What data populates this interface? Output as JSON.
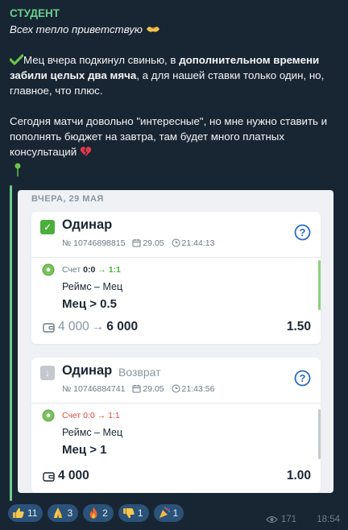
{
  "author": "СТУДЕНТ",
  "greeting": "Всех тепло приветствую",
  "para1": {
    "part1": "Мец вчера подкинул свинью, в ",
    "bold": "дополнительном времени забили целых два мяча",
    "part2": ", а для нашей ставки только один, но, главное, что плюс."
  },
  "para2": "Сегодня матчи довольно \"интересные\", но мне нужно ставить и пополнять бюджет на завтра, там будет много платных консультаций",
  "screenshot": {
    "date_label": "ВЧЕРА, 29 МАЯ",
    "bets": [
      {
        "status": "win",
        "type": "Одинар",
        "state": "",
        "number": "№ 10746898815",
        "date": "29.05",
        "time": "21:44:13",
        "score_label": "Счет",
        "score_from": "0:0",
        "score_to": "1:1",
        "teams": "Реймс – Мец",
        "pick": "Мец > 0.5",
        "stake": "4 000",
        "payout": "6 000",
        "odds": "1.50"
      },
      {
        "status": "return",
        "type": "Одинар",
        "state": "Возврат",
        "number": "№ 10746884741",
        "date": "29.05",
        "time": "21:43:56",
        "score_label": "Счет",
        "score_from": "0:0",
        "score_to": "1:1",
        "teams": "Реймс – Мец",
        "pick": "Мец > 1",
        "stake": "4 000",
        "payout": "",
        "odds": "1.00"
      }
    ]
  },
  "reactions": [
    {
      "emoji": "thumbs-up",
      "count": "11"
    },
    {
      "emoji": "folded-hands",
      "count": "3"
    },
    {
      "emoji": "fire",
      "count": "2"
    },
    {
      "emoji": "thumbs-down",
      "count": "1"
    },
    {
      "emoji": "party-popper",
      "count": "1"
    }
  ],
  "views": "171",
  "time": "18:54",
  "colors": {
    "background": "#17212b",
    "author": "#6ad08e",
    "win": "#4caf3d",
    "loss": "#e0483e",
    "reaction_bg": "#2b5278"
  }
}
